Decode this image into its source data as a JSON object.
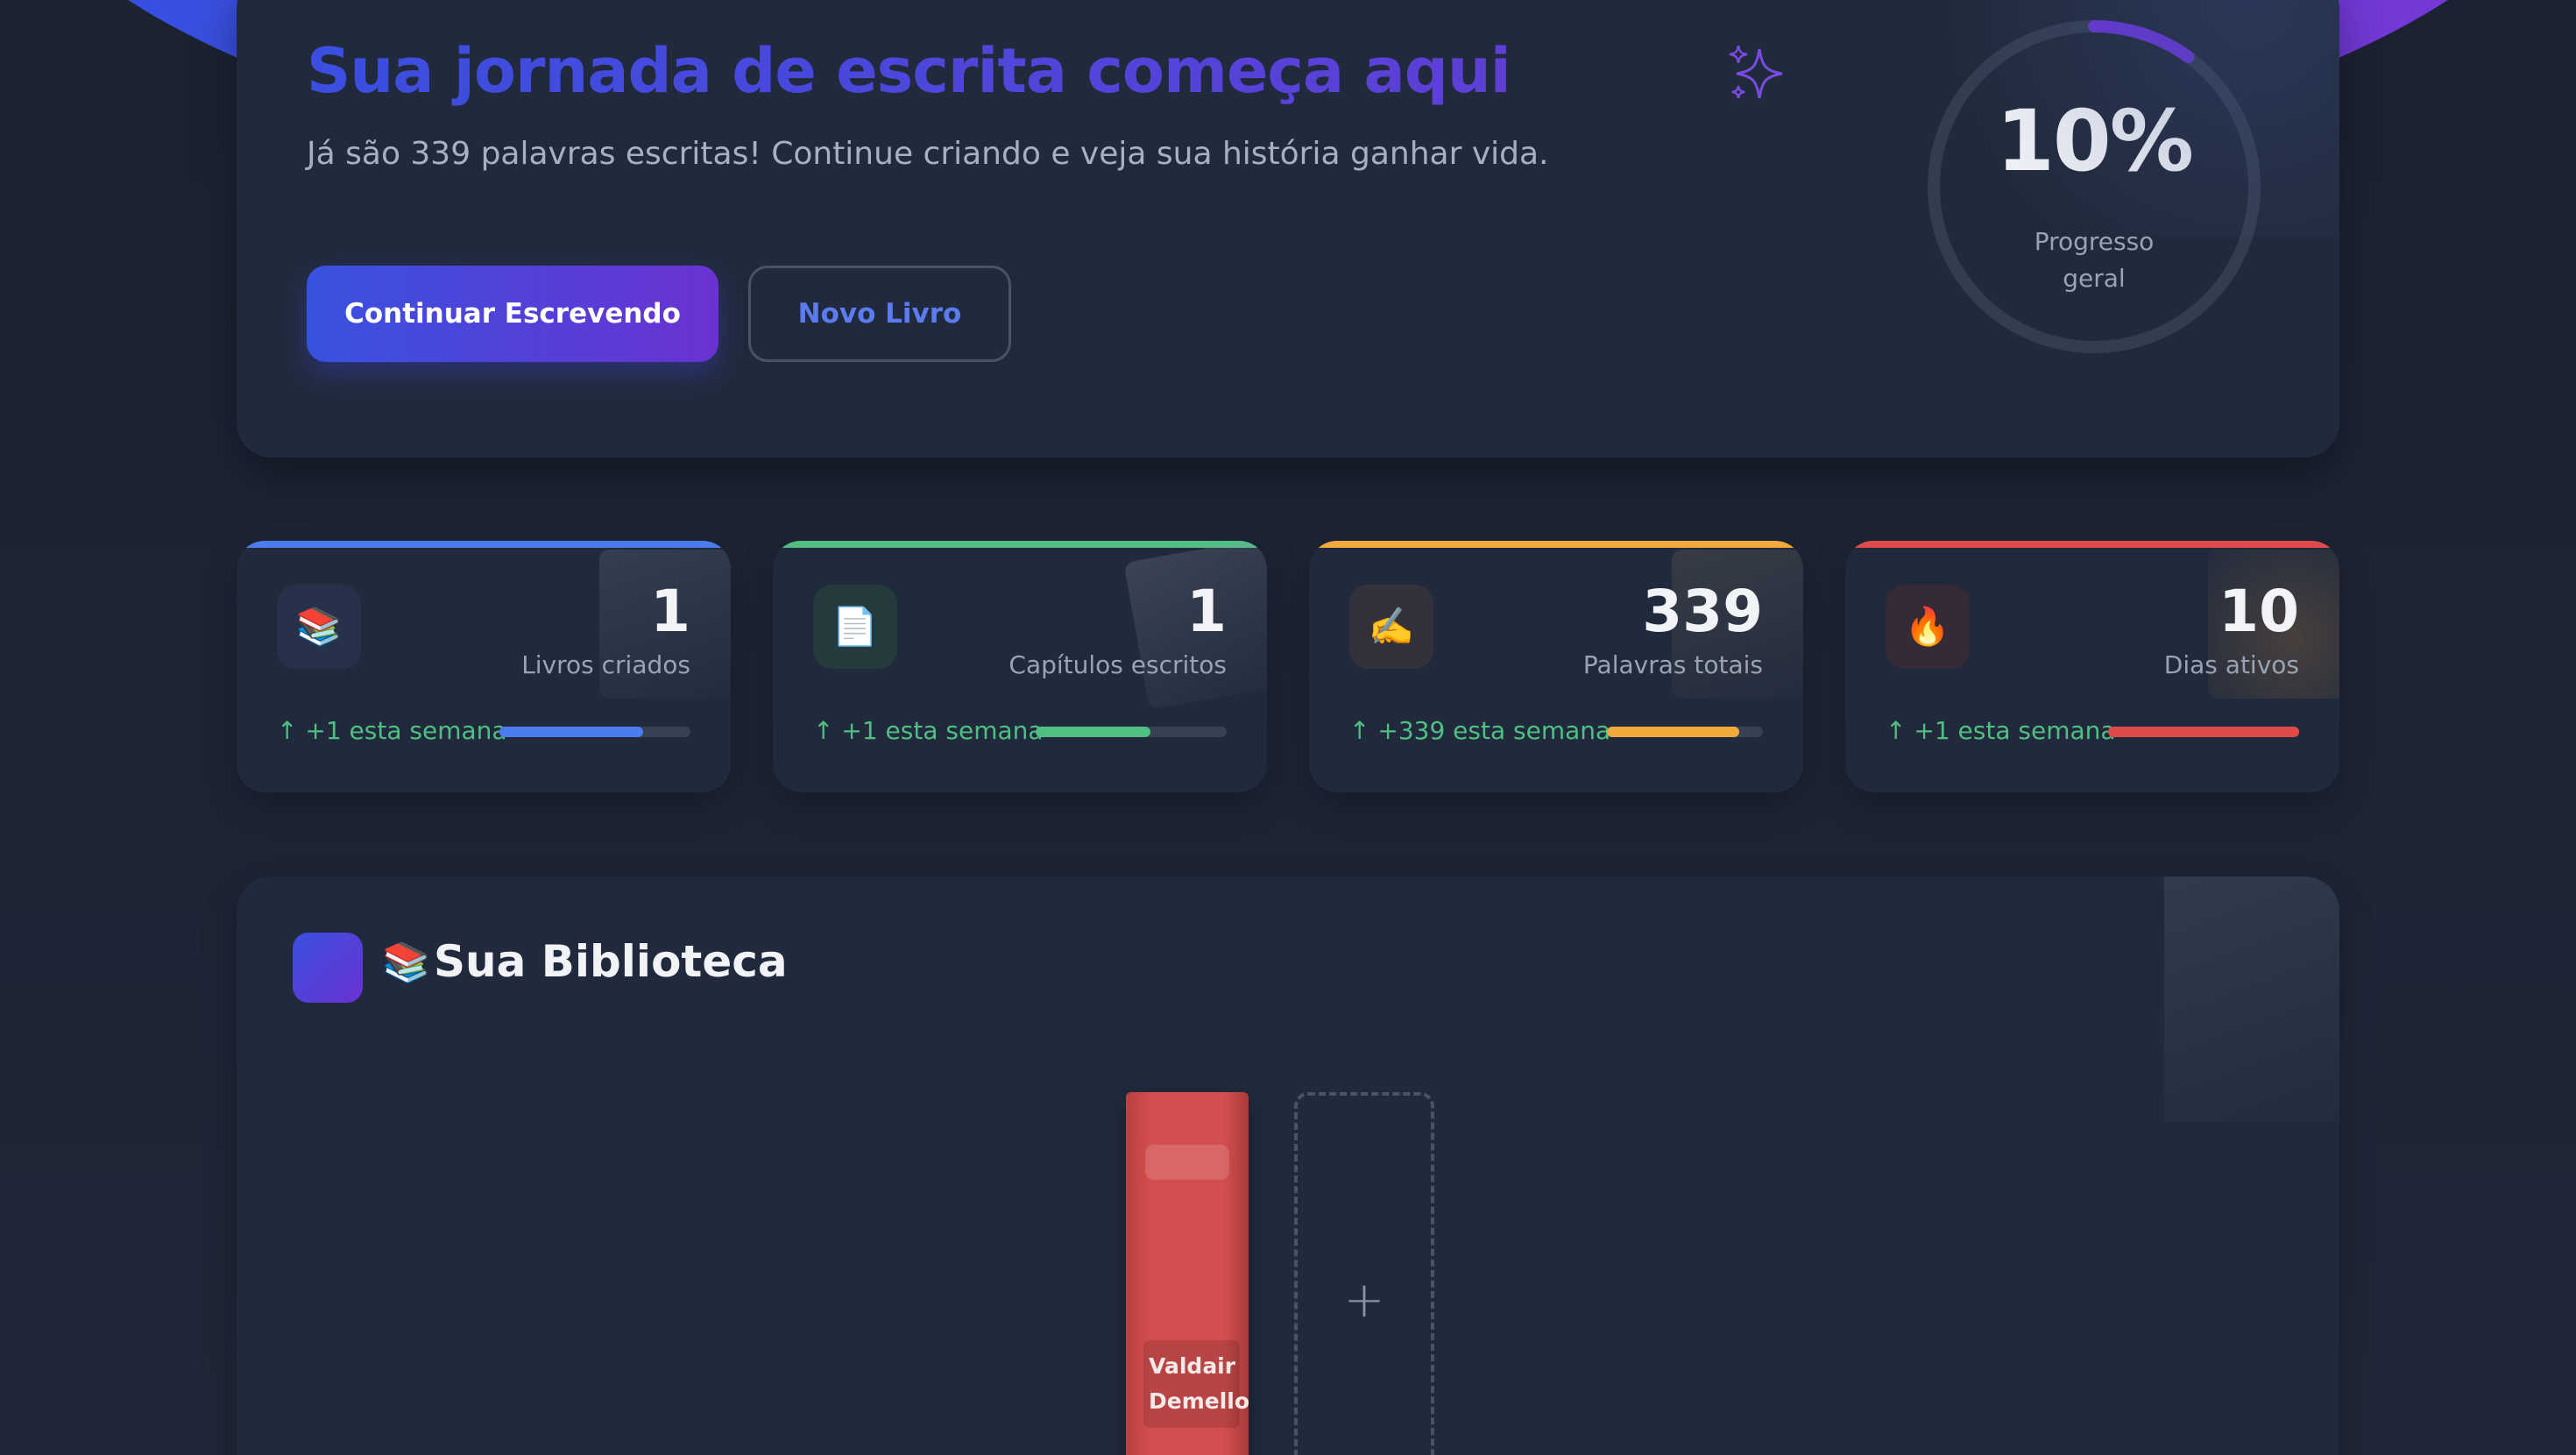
{
  "hero": {
    "title": "Sua jornada de escrita começa aqui",
    "subtitle": "Já são 339 palavras escritas! Continue criando e veja sua história ganhar vida.",
    "primary_button": "Continuar Escrevendo",
    "secondary_button": "Novo Livro",
    "progress": {
      "value_text": "10%",
      "value": 10,
      "label": "Progresso geral"
    }
  },
  "stats": [
    {
      "icon": "books-icon",
      "emoji": "📚",
      "value": "1",
      "label": "Livros criados",
      "delta": "↑ +1 esta semana",
      "progress": 0.75,
      "color": "#4a7cf0",
      "icon_bg": "#27324a"
    },
    {
      "icon": "page-icon",
      "emoji": "📄",
      "value": "1",
      "label": "Capítulos escritos",
      "delta": "↑ +1 esta semana",
      "progress": 0.6,
      "color": "#4fbf82",
      "icon_bg": "#243a3c"
    },
    {
      "icon": "writing-hand-icon",
      "emoji": "✍️",
      "value": "339",
      "label": "Palavras totais",
      "delta": "↑ +339 esta semana",
      "progress": 0.85,
      "color": "#f2a93b",
      "icon_bg": "#33323a"
    },
    {
      "icon": "fire-icon",
      "emoji": "🔥",
      "value": "10",
      "label": "Dias ativos",
      "delta": "↑ +1 esta semana",
      "progress": 1.0,
      "color": "#e04a4a",
      "icon_bg": "#352a36"
    }
  ],
  "library": {
    "emoji": "📚",
    "title": "Sua Biblioteca",
    "books": [
      {
        "author": "Valdair Demello",
        "color": "#d34e4e"
      }
    ],
    "add_label": "+"
  }
}
